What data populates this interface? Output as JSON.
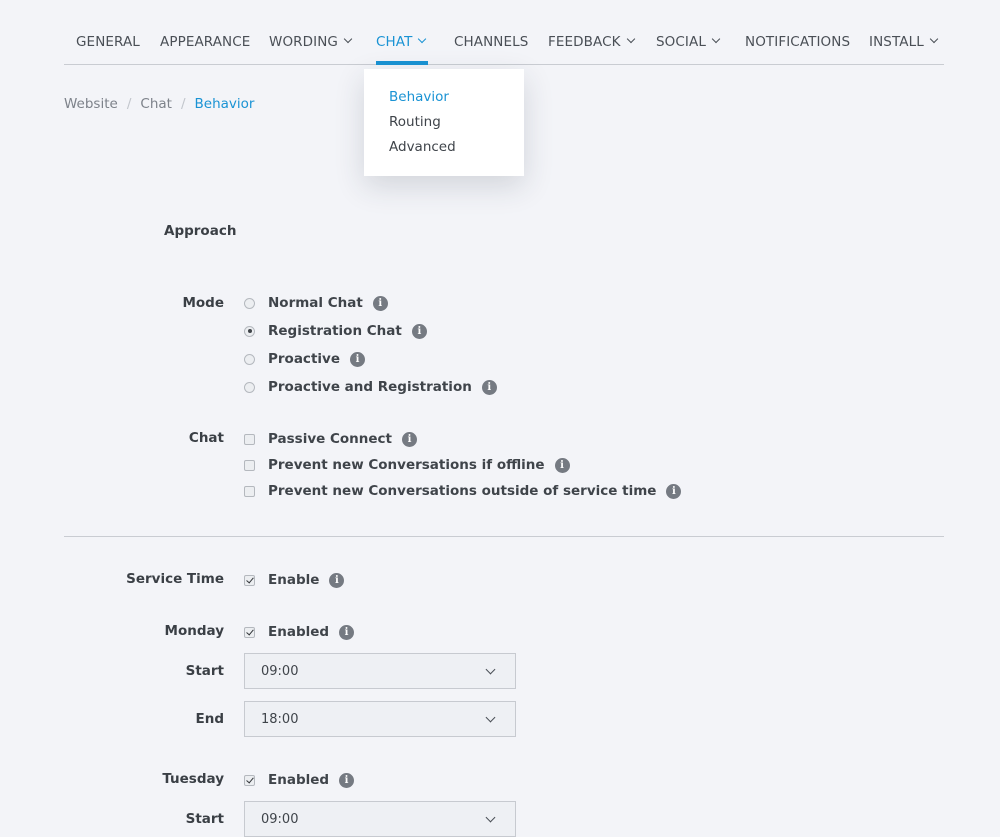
{
  "nav": {
    "items": [
      {
        "label": "GENERAL",
        "has_dropdown": false
      },
      {
        "label": "APPEARANCE",
        "has_dropdown": false
      },
      {
        "label": "WORDING",
        "has_dropdown": true
      },
      {
        "label": "CHAT",
        "has_dropdown": true,
        "active": true
      },
      {
        "label": "CHANNELS",
        "has_dropdown": false
      },
      {
        "label": "FEEDBACK",
        "has_dropdown": true
      },
      {
        "label": "SOCIAL",
        "has_dropdown": true
      },
      {
        "label": "NOTIFICATIONS",
        "has_dropdown": false
      },
      {
        "label": "INSTALL",
        "has_dropdown": true
      }
    ]
  },
  "chat_menu": {
    "items": [
      "Behavior",
      "Routing",
      "Advanced"
    ],
    "active": "Behavior"
  },
  "breadcrumb": [
    "Website",
    "Chat",
    "Behavior"
  ],
  "approach": {
    "title": "Approach"
  },
  "mode": {
    "label": "Mode",
    "options": [
      {
        "label": "Normal Chat",
        "selected": false
      },
      {
        "label": "Registration Chat",
        "selected": true
      },
      {
        "label": "Proactive",
        "selected": false
      },
      {
        "label": "Proactive and Registration",
        "selected": false
      }
    ]
  },
  "chat": {
    "label": "Chat",
    "options": [
      {
        "label": "Passive Connect",
        "checked": false
      },
      {
        "label": "Prevent new Conversations if offline",
        "checked": false
      },
      {
        "label": "Prevent new Conversations outside of service time",
        "checked": false
      }
    ]
  },
  "service_time": {
    "label": "Service Time",
    "option": "Enable",
    "checked": true
  },
  "days": [
    {
      "label": "Monday",
      "option": "Enabled",
      "checked": true,
      "start_label": "Start",
      "start": "09:00",
      "end_label": "End",
      "end": "18:00"
    },
    {
      "label": "Tuesday",
      "option": "Enabled",
      "checked": true,
      "start_label": "Start",
      "start": "09:00"
    }
  ],
  "icons": {
    "info": "info-icon",
    "chevron": "chevron-down-icon"
  },
  "colors": {
    "accent": "#1a93d4",
    "info_icon": "#757a82",
    "background": "#f3f4f8"
  }
}
